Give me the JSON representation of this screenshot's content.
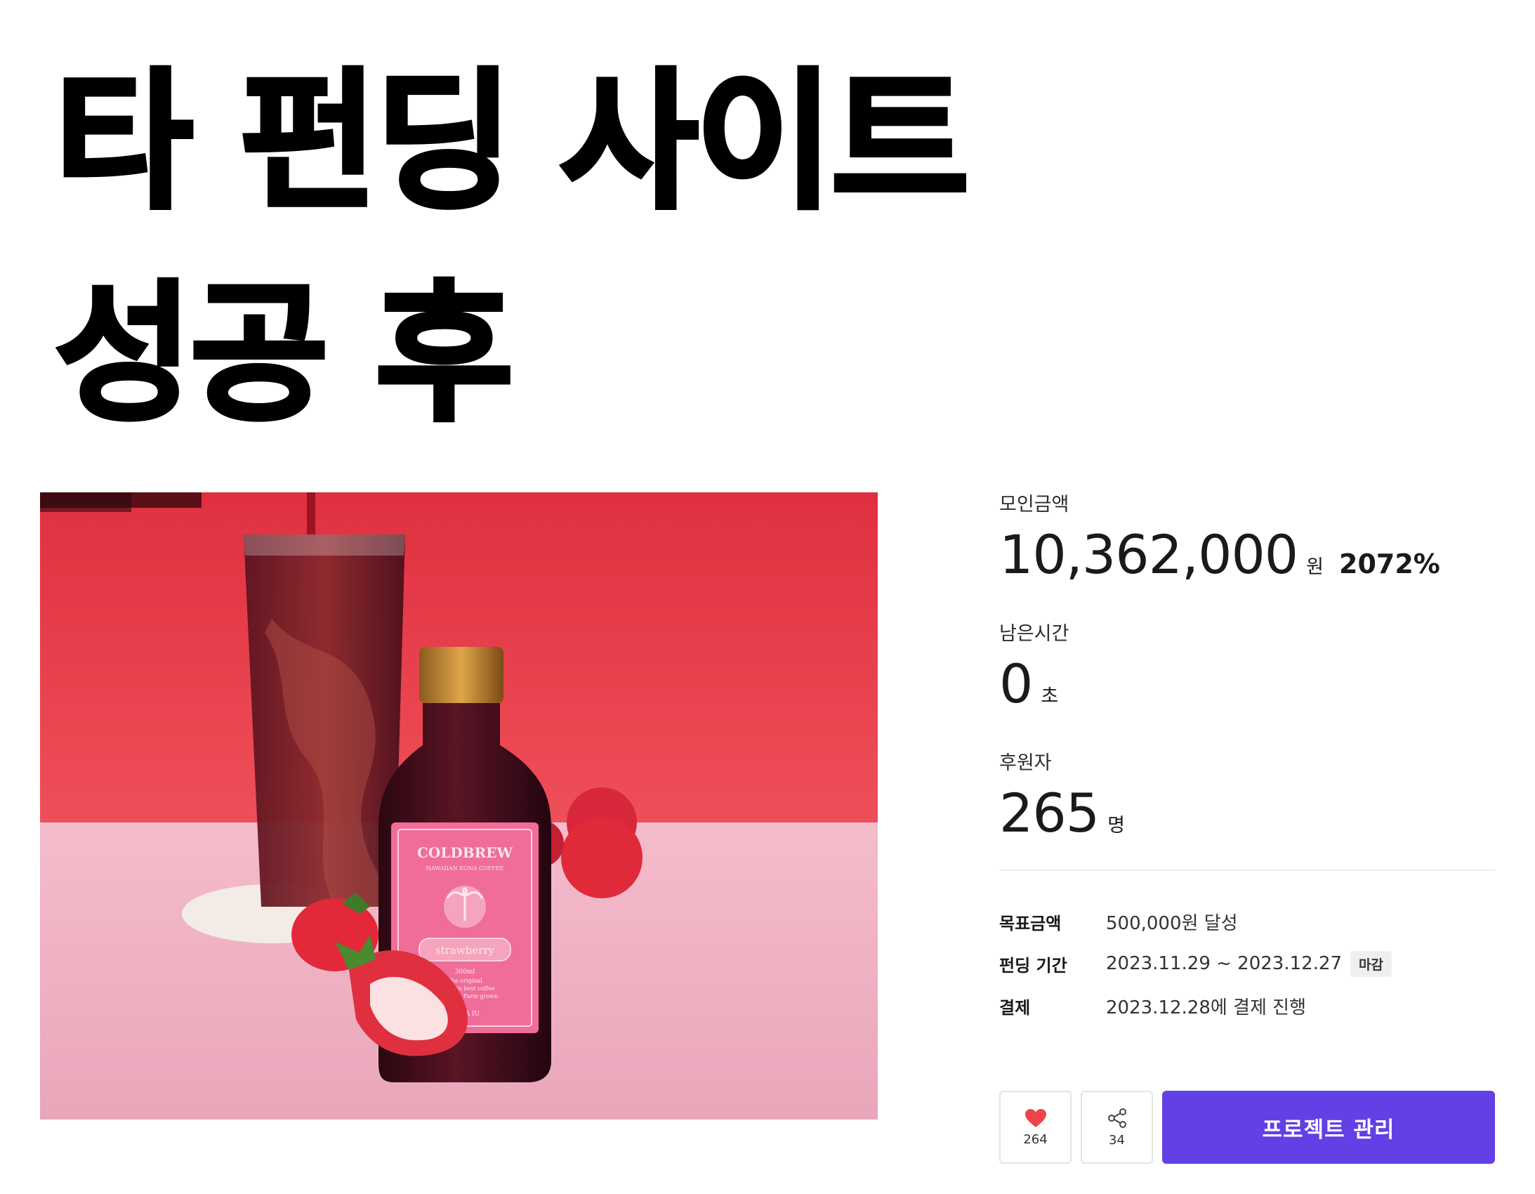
{
  "headline": {
    "line1": "타 펀딩 사이트",
    "line2": "성공 후"
  },
  "product_image": {
    "label_brand": "COLDBREW",
    "label_sub": "HAWAIIAN KONA COFFEE",
    "label_flavor": "strawberry",
    "label_volume": "300ml",
    "label_desc1": "The original",
    "label_desc2": "Hawaiian best coffee",
    "label_desc3": "GMO Free Farm grown",
    "label_maker": "KONA IU"
  },
  "stats": {
    "raised": {
      "label": "모인금액",
      "value": "10,362,000",
      "unit": "원",
      "percent": "2072%"
    },
    "remaining": {
      "label": "남은시간",
      "value": "0",
      "unit": "초"
    },
    "backers": {
      "label": "후원자",
      "value": "265",
      "unit": "명"
    }
  },
  "details": {
    "goal": {
      "key": "목표금액",
      "value": "500,000원 달성"
    },
    "period": {
      "key": "펀딩 기간",
      "value": "2023.11.29 ~ 2023.12.27",
      "badge": "마감"
    },
    "payment": {
      "key": "결제",
      "value": "2023.12.28에 결제 진행"
    }
  },
  "actions": {
    "like": {
      "icon": "heart-icon",
      "count": "264"
    },
    "share": {
      "icon": "share-icon",
      "count": "34"
    },
    "manage_label": "프로젝트 관리"
  },
  "colors": {
    "primary": "#6340e6",
    "heart": "#f0434f",
    "photo_wall": "#e8404f",
    "photo_table": "#f3b7c6"
  }
}
